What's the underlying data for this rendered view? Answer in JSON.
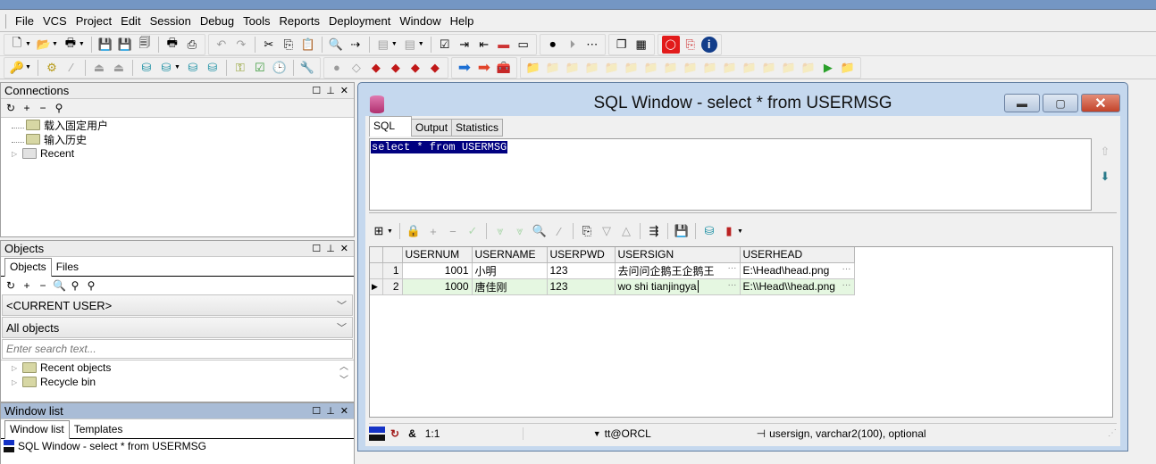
{
  "app": {
    "title_bar_partial": ""
  },
  "menu": [
    "File",
    "VCS",
    "Project",
    "Edit",
    "Session",
    "Debug",
    "Tools",
    "Reports",
    "Deployment",
    "Window",
    "Help"
  ],
  "menu_mnemonics": [
    "F",
    "V",
    "P",
    "E",
    "S",
    "D",
    "T",
    "R",
    "",
    "W",
    "H"
  ],
  "toolbar1": {
    "icons": [
      "new-icon",
      "open-icon",
      "print-menu-icon",
      "save-icon",
      "save-as-icon",
      "save-all-icon",
      "print-icon",
      "print-setup-icon",
      "undo-icon",
      "redo-icon",
      "cut-icon",
      "copy-icon",
      "paste-icon",
      "find-icon",
      "find-next-icon",
      "execute-icon",
      "step-icon",
      "syntax-check-icon",
      "indent-icon",
      "unindent-icon",
      "comment-icon",
      "uncomment-icon",
      "record-macro-icon",
      "play-macro-icon",
      "macro-library-icon",
      "cascade-windows-icon",
      "tile-windows-icon",
      "oracle-icon",
      "pdf-icon",
      "info-icon"
    ]
  },
  "toolbar2": {
    "icons": [
      "log-on-icon",
      "compile-icon",
      "debug-disabled-icon",
      "export-icon",
      "import-icon",
      "sql-window-icon",
      "new-sql-icon",
      "execute-query-icon",
      "break-icon",
      "key-icon",
      "test-icon",
      "schedule-icon",
      "wrench-icon",
      "commit-icon",
      "rollback-icon",
      "red-book-icon",
      "yellow-book-icon",
      "book-copy-icon",
      "book-edit-icon",
      "go-forward-blue-icon",
      "go-forward-red-icon",
      "toolbox-icon",
      "folder-icons"
    ]
  },
  "connections": {
    "title": "Connections",
    "items": [
      {
        "label": "载入固定用户",
        "type": "folder"
      },
      {
        "label": "输入历史",
        "type": "folder"
      },
      {
        "label": "Recent",
        "type": "folder",
        "expandable": true
      }
    ]
  },
  "objects": {
    "title": "Objects",
    "tabs": [
      "Objects",
      "Files"
    ],
    "active_tab": "Objects",
    "user_select": "<CURRENT USER>",
    "filter_select": "All objects",
    "search_placeholder": "Enter search text...",
    "items": [
      {
        "label": "Recent objects"
      },
      {
        "label": "Recycle bin"
      }
    ]
  },
  "window_list": {
    "title": "Window list",
    "tabs": [
      "Window list",
      "Templates"
    ],
    "active_tab": "Window list",
    "items": [
      "SQL Window - select * from USERMSG"
    ]
  },
  "sql_window": {
    "title": "SQL Window - select * from USERMSG",
    "tabs": [
      "SQL",
      "Output",
      "Statistics"
    ],
    "active_tab": "SQL",
    "sql_text": "select * from USERMSG",
    "grid": {
      "columns": [
        "USERNUM",
        "USERNAME",
        "USERPWD",
        "USERSIGN",
        "USERHEAD"
      ],
      "rows": [
        {
          "row_num": "1",
          "USERNUM": "1001",
          "USERNAME": "小明",
          "USERPWD": "123",
          "USERSIGN": "去问问企鹅王企鹅王",
          "USERHEAD": "E:\\Head\\head.png",
          "current": false
        },
        {
          "row_num": "2",
          "USERNUM": "1000",
          "USERNAME": "唐佳刚",
          "USERPWD": "123",
          "USERSIGN": "wo shi tianjingya",
          "USERHEAD": "E:\\\\Head\\\\head.png",
          "current": true
        }
      ]
    },
    "status": {
      "position": "1:1",
      "connection": "tt@ORCL",
      "field_info": "usersign, varchar2(100), optional"
    }
  }
}
